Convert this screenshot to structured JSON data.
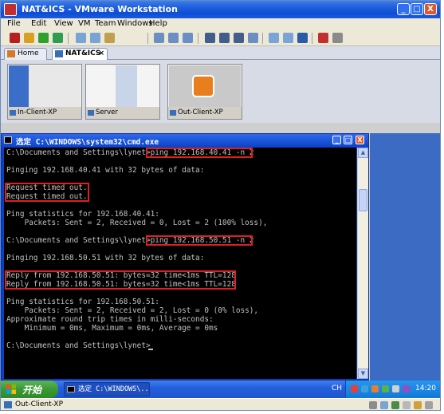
{
  "window": {
    "title": "NAT&ICS - VMware Workstation",
    "minimize": "_",
    "maximize": "□",
    "close": "X"
  },
  "menu": [
    "File",
    "Edit",
    "View",
    "VM",
    "Team",
    "Windows",
    "Help"
  ],
  "tabs": [
    {
      "label": "Home",
      "active": false
    },
    {
      "label": "NAT&ICS",
      "active": true
    }
  ],
  "tab_close": "×",
  "thumbnails": [
    {
      "label": "In-Client-XP"
    },
    {
      "label": "Server"
    },
    {
      "label": "Out-Client-XP"
    }
  ],
  "cmd": {
    "title": "选定 C:\\WINDOWS\\system32\\cmd.exe",
    "lines": [
      "C:\\Documents and Settings\\lynet>ping 192.168.40.41 -n 2",
      "",
      "Pinging 192.168.40.41 with 32 bytes of data:",
      "",
      "Request timed out.",
      "Request timed out.",
      "",
      "Ping statistics for 192.168.40.41:",
      "    Packets: Sent = 2, Received = 0, Lost = 2 (100% loss),",
      "",
      "C:\\Documents and Settings\\lynet>ping 192.168.50.51 -n 2",
      "",
      "Pinging 192.168.50.51 with 32 bytes of data:",
      "",
      "Reply from 192.168.50.51: bytes=32 time<1ms TTL=128",
      "Reply from 192.168.50.51: bytes=32 time<1ms TTL=128",
      "",
      "Ping statistics for 192.168.50.51:",
      "    Packets: Sent = 2, Received = 2, Lost = 0 (0% loss),",
      "Approximate round trip times in milli-seconds:",
      "    Minimum = 0ms, Maximum = 0ms, Average = 0ms",
      "",
      "C:\\Documents and Settings\\lynet>"
    ]
  },
  "taskbar": {
    "start_label": "开始",
    "task_item": "选定 C:\\WINDOWS\\...",
    "language": "CH",
    "clock": "14:20"
  },
  "statusbar": {
    "vm_name": "Out-Client-XP"
  },
  "colors": {
    "highlight_box": "#e01f1f",
    "console_bg": "#000000",
    "console_text": "#c0c0c0",
    "title_blue": "#0d4ed6"
  }
}
